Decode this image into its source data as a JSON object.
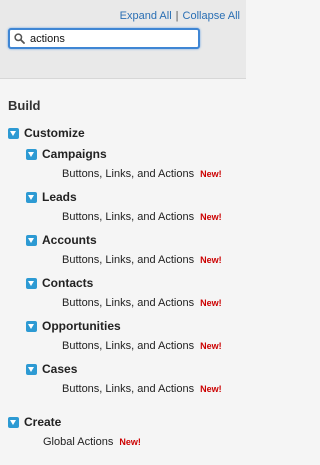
{
  "header": {
    "expand_all": "Expand All",
    "separator": "|",
    "collapse_all": "Collapse All"
  },
  "search": {
    "value": "actions",
    "icon": "search-icon"
  },
  "section": {
    "title": "Build"
  },
  "tree": {
    "customize": {
      "label": "Customize",
      "children": [
        {
          "label": "Campaigns",
          "leaf": "Buttons, Links, and Actions",
          "badge": "New!"
        },
        {
          "label": "Leads",
          "leaf": "Buttons, Links, and Actions",
          "badge": "New!"
        },
        {
          "label": "Accounts",
          "leaf": "Buttons, Links, and Actions",
          "badge": "New!"
        },
        {
          "label": "Contacts",
          "leaf": "Buttons, Links, and Actions",
          "badge": "New!"
        },
        {
          "label": "Opportunities",
          "leaf": "Buttons, Links, and Actions",
          "badge": "New!"
        },
        {
          "label": "Cases",
          "leaf": "Buttons, Links, and Actions",
          "badge": "New!"
        }
      ]
    },
    "create": {
      "label": "Create",
      "leaf": "Global Actions",
      "badge": "New!"
    }
  },
  "colors": {
    "accent": "#2d9ad3",
    "link": "#2a6fb4",
    "badge": "#cc0000"
  }
}
